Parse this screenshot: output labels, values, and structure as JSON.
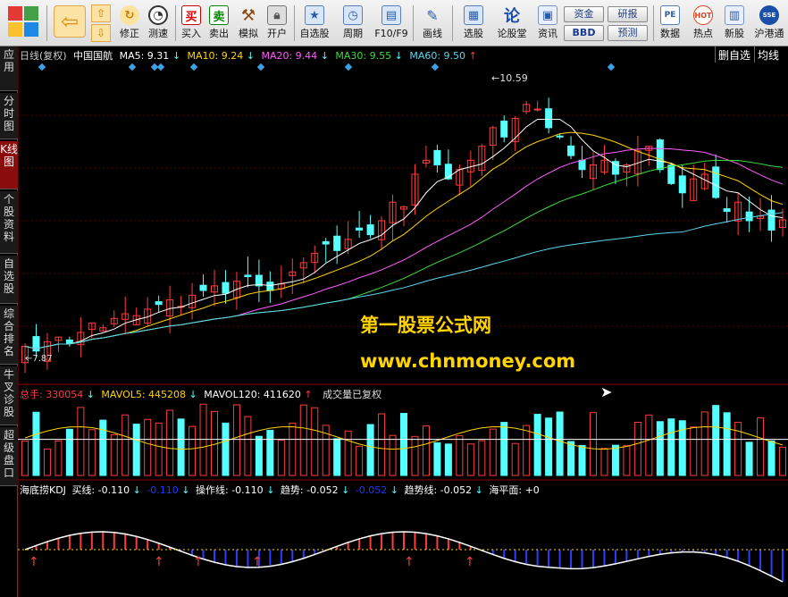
{
  "toolbar": {
    "buttons": [
      {
        "label": "修正",
        "icon": "fix-icon"
      },
      {
        "label": "测速",
        "icon": "speed-test-icon"
      },
      {
        "label": "买入",
        "icon": "buy-icon",
        "glyph": "买"
      },
      {
        "label": "卖出",
        "icon": "sell-icon",
        "glyph": "卖"
      },
      {
        "label": "模拟",
        "icon": "simulate-icon"
      },
      {
        "label": "开户",
        "icon": "lock-icon"
      },
      {
        "label": "自选股",
        "icon": "star-icon"
      },
      {
        "label": "周期",
        "icon": "period-icon"
      },
      {
        "label": "F10/F9",
        "icon": "f10-icon"
      },
      {
        "label": "画线",
        "icon": "pen-icon"
      },
      {
        "label": "选股",
        "icon": "screener-icon"
      },
      {
        "label": "论股堂",
        "icon": "forum-icon",
        "glyph": "论"
      },
      {
        "label": "资讯",
        "icon": "news-icon"
      },
      {
        "label": "数据",
        "icon": "pe-icon",
        "glyph": "PE"
      },
      {
        "label": "热点",
        "icon": "hot-icon",
        "glyph": "HOT"
      },
      {
        "label": "新股",
        "icon": "new-stock-icon"
      },
      {
        "label": "沪港通",
        "icon": "hk-connect-icon"
      }
    ],
    "small_buttons": [
      "资金",
      "BBD",
      "研报",
      "预测"
    ]
  },
  "left_tabs": [
    "应用",
    "分时图",
    "K线图",
    "个股资料",
    "自选股",
    "综合排名",
    "牛叉诊股",
    "超级盘口"
  ],
  "right_tabs": [
    "删自选",
    "均线"
  ],
  "price_legend": {
    "title": "日线(复权)",
    "stock": "中国国航",
    "ma": [
      {
        "label": "MA5: 9.31",
        "arrow": "↓",
        "color": "#ffffff"
      },
      {
        "label": "MA10: 9.24",
        "arrow": "↓",
        "color": "#ffd400"
      },
      {
        "label": "MA20: 9.44",
        "arrow": "↓",
        "color": "#ff5cff"
      },
      {
        "label": "MA30: 9.55",
        "arrow": "↓",
        "color": "#3cdc3c"
      },
      {
        "label": "MA60: 9.50",
        "arrow": "↑",
        "color": "#5fd5f0"
      }
    ]
  },
  "price_annotations": {
    "high": "10.59",
    "low": "7.87"
  },
  "volume_legend": {
    "total": "总手: 330054",
    "mavol5": "MAVOL5: 445208",
    "mavol120": "MAVOL120: 411620",
    "note": "成交量已复权"
  },
  "kdj_legend": {
    "name": "海底捞KDJ",
    "buy": "买线: -0.110",
    "mid": "-0.110",
    "op": "操作线: -0.110",
    "trend": "趋势: -0.052",
    "trend2": "-0.052",
    "trendline": "趋势线: -0.052",
    "sea": "海平面: +0"
  },
  "watermark": {
    "line1": "第一股票公式网",
    "line2": "www.chnmoney.com"
  },
  "colors": {
    "up": "#ff3c3c",
    "down": "#54ffff",
    "ma5": "#ffffff",
    "ma10": "#ffd400",
    "ma20": "#ff5cff",
    "ma30": "#3cdc3c",
    "ma60": "#5fd5f0"
  },
  "chart_data": {
    "type": "candlestick",
    "price_range": [
      7.6,
      11.0
    ],
    "closes": [
      7.95,
      7.9,
      8.0,
      8.05,
      7.98,
      8.1,
      8.2,
      8.15,
      8.25,
      8.3,
      8.28,
      8.35,
      8.4,
      8.45,
      8.38,
      8.5,
      8.55,
      8.6,
      8.52,
      8.65,
      8.7,
      8.6,
      8.55,
      8.62,
      8.75,
      8.85,
      8.95,
      9.05,
      8.98,
      9.1,
      9.2,
      9.15,
      9.3,
      9.5,
      9.45,
      9.8,
      9.95,
      9.9,
      9.75,
      9.85,
      9.95,
      10.1,
      10.3,
      10.2,
      10.4,
      10.55,
      10.5,
      10.3,
      10.2,
      10.0,
      9.85,
      9.9,
      9.95,
      9.8,
      9.9,
      10.05,
      10.1,
      9.85,
      9.7,
      9.6,
      9.75,
      9.8,
      9.55,
      9.4,
      9.5,
      9.3,
      9.35,
      9.2,
      9.31
    ]
  }
}
